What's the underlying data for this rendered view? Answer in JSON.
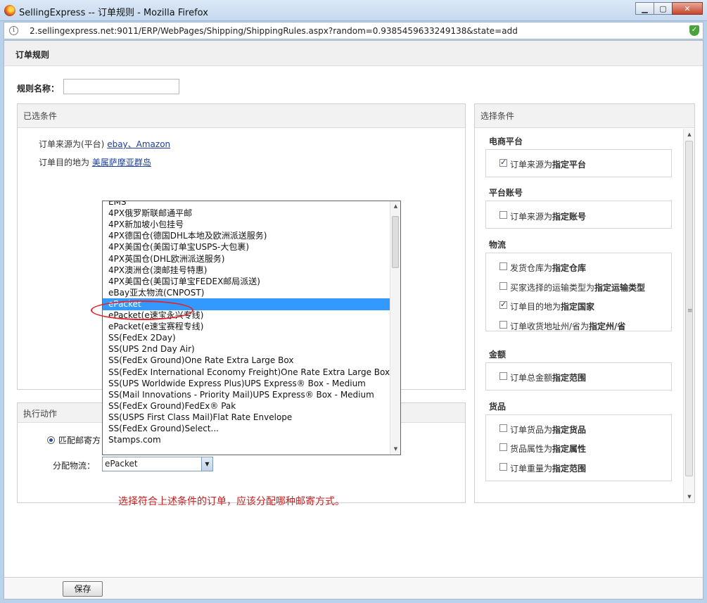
{
  "window": {
    "title": "SellingExpress -- 订单规则 - Mozilla Firefox"
  },
  "urlbar": {
    "url": "2.sellingexpress.net:9011/ERP/WebPages/Shipping/ShippingRules.aspx?random=0.9385459633249138&state=add"
  },
  "page": {
    "header": "订单规则",
    "rule_name_label": "规则名称：",
    "rule_name_value": ""
  },
  "selected": {
    "title": "已选条件",
    "conditions": [
      {
        "prefix": "订单来源为(平台) ",
        "link": "ebay、Amazon"
      },
      {
        "prefix": "订单目的地为 ",
        "link": "美属萨摩亚群岛"
      }
    ]
  },
  "action": {
    "title": "执行动作",
    "radio_label": "匹配邮寄方",
    "assign_label": "分配物流：",
    "assign_value": "ePacket"
  },
  "hint": "选择符合上述条件的订单，应该分配哪种邮寄方式。",
  "dropdown": {
    "items": [
      "EMS",
      "4PX俄罗斯联邮通平邮",
      "4PX新加坡小包挂号",
      "4PX德国仓(德国DHL本地及欧洲派送服务)",
      "4PX美国仓(美国订单宝USPS-大包裹)",
      "4PX英国仓(DHL欧洲派送服务)",
      "4PX澳洲仓(澳邮挂号特惠)",
      "4PX美国仓(美国订单宝FEDEX邮局派送)",
      "eBay亚太物流(CNPOST)",
      "ePacket",
      "ePacket(e速宝永兴专线)",
      "ePacket(e速宝赛程专线)",
      "SS(FedEx 2Day)",
      "SS(UPS 2nd Day Air)",
      "SS(FedEx Ground)One Rate Extra Large Box",
      "SS(FedEx International Economy Freight)One Rate Extra Large Box",
      "SS(UPS Worldwide Express Plus)UPS Express® Box - Medium",
      "SS(Mail Innovations - Priority Mail)UPS Express® Box - Medium",
      "SS(FedEx Ground)FedEx® Pak",
      "SS(USPS First Class Mail)Flat Rate Envelope",
      "SS(FedEx Ground)Select...",
      "Stamps.com"
    ],
    "selected": "ePacket"
  },
  "choose": {
    "title": "选择条件",
    "groups": [
      {
        "title": "电商平台",
        "options": [
          {
            "pre": "订单来源为",
            "bold": "指定平台",
            "checked": true
          }
        ]
      },
      {
        "title": "平台账号",
        "options": [
          {
            "pre": "订单来源为",
            "bold": "指定账号",
            "checked": false
          }
        ]
      },
      {
        "title": "物流",
        "options": [
          {
            "pre": "发货仓库为",
            "bold": "指定仓库",
            "checked": false
          },
          {
            "pre": "买家选择的运输类型为",
            "bold": "指定运输类型",
            "checked": false
          },
          {
            "pre": "订单目的地为",
            "bold": "指定国家",
            "checked": true
          },
          {
            "pre": "订单收货地址州/省为",
            "bold": "指定州/省",
            "checked": false
          }
        ]
      },
      {
        "title": "金额",
        "options": [
          {
            "pre": "订单总金额",
            "bold": "指定范围",
            "checked": false
          }
        ]
      },
      {
        "title": "货品",
        "options": [
          {
            "pre": "订单货品为",
            "bold": "指定货品",
            "checked": false
          },
          {
            "pre": "货品属性为",
            "bold": "指定属性",
            "checked": false
          },
          {
            "pre": "订单重量为",
            "bold": "指定范围",
            "checked": false
          }
        ]
      }
    ]
  },
  "footer": {
    "save_label": "保存"
  },
  "colors": {
    "accent": "#3399ff",
    "hint": "#c41f1f",
    "link": "#1a3e9c",
    "highlight_ring": "#e0252b"
  }
}
